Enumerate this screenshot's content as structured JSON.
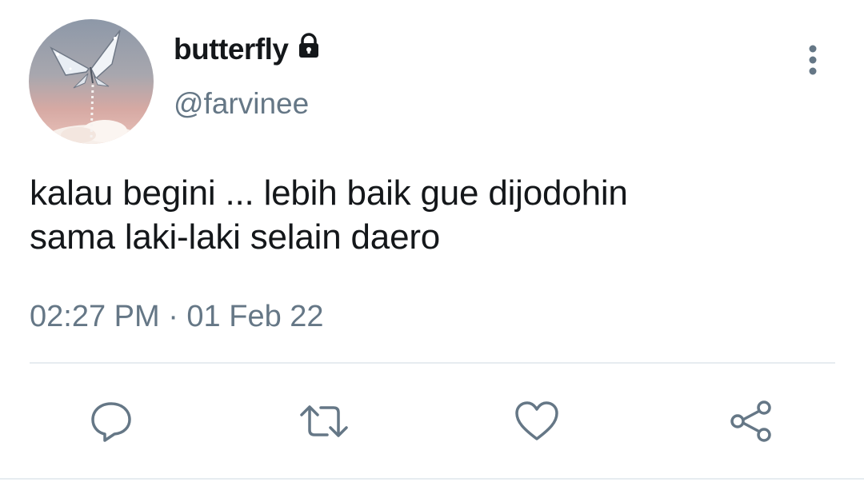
{
  "user": {
    "display_name": "butterfly",
    "handle": "@farvinee",
    "protected_icon": "lock-icon",
    "avatar_icon": "butterfly-avatar"
  },
  "tweet": {
    "text_lines": [
      "kalau begini ... lebih baik gue dijodohin",
      "sama laki-laki selain daero"
    ],
    "timestamp": "02:27 PM · 01 Feb 22"
  },
  "actions": [
    {
      "name": "reply",
      "icon": "speech-bubble-icon"
    },
    {
      "name": "retweet",
      "icon": "retweet-arrows-icon"
    },
    {
      "name": "like",
      "icon": "heart-icon"
    },
    {
      "name": "share",
      "icon": "share-nodes-icon"
    }
  ],
  "colors": {
    "text_primary": "#14171a",
    "text_secondary": "#657786",
    "icon": "#657786",
    "divider": "#e6ecf0"
  }
}
